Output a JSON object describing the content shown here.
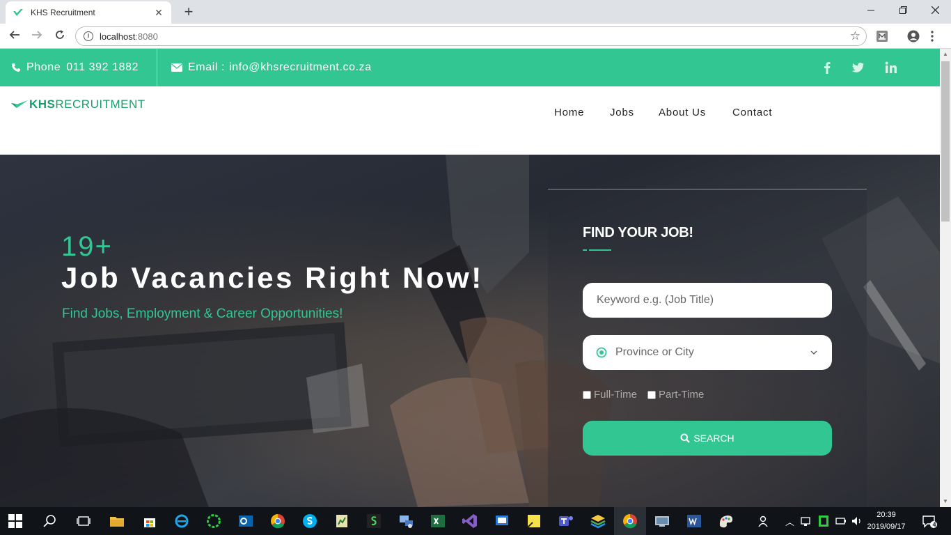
{
  "browser": {
    "tab_title": "KHS Recruitment",
    "tab_close": "✕",
    "new_tab": "+",
    "url_host": "localhost",
    "url_port": ":8080",
    "info": "i"
  },
  "topbar": {
    "phone_label": "Phone",
    "phone_number": "011 392 1882",
    "email_label": "Email :",
    "email": "info@khsrecruitment.co.za",
    "social": [
      "facebook-icon",
      "twitter-icon",
      "linkedin-icon"
    ],
    "color": "#32c692"
  },
  "header": {
    "logo_bold": "KHS",
    "logo_light": "RECRUITMENT",
    "nav": [
      "Home",
      "Jobs",
      "About Us",
      "Contact"
    ]
  },
  "hero": {
    "count": "19+",
    "title": "Job Vacancies Right Now!",
    "subtitle": "Find Jobs, Employment & Career Opportunities!"
  },
  "search_panel": {
    "title": "FIND YOUR JOB!",
    "keyword_placeholder": "Keyword e.g. (Job Title)",
    "location_placeholder": "Province or City",
    "full_time": "Full-Time",
    "part_time": "Part-Time",
    "button": "SEARCH"
  },
  "taskbar": {
    "time": "20:39",
    "date": "2019/09/17",
    "notifications": "4"
  }
}
